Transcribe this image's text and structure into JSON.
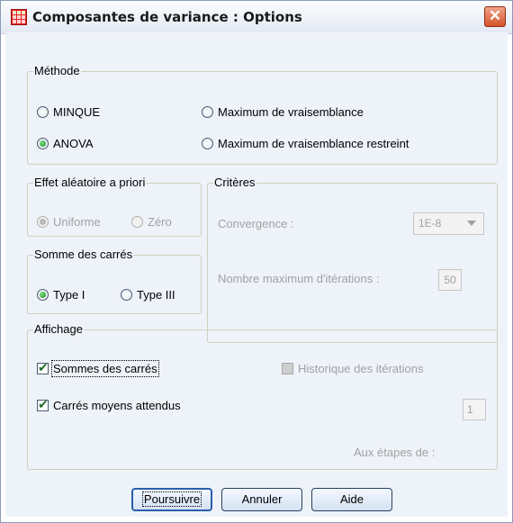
{
  "window": {
    "title": "Composantes de variance : Options",
    "close_glyph": "✕"
  },
  "methode": {
    "label": "Méthode",
    "options": [
      "MINQUE",
      "ANOVA",
      "Maximum de vraisemblance",
      "Maximum de vraisemblance restreint"
    ],
    "selected": "ANOVA"
  },
  "effet": {
    "label": "Effet aléatoire a priori",
    "options": [
      "Uniforme",
      "Zéro"
    ],
    "selected": "Uniforme",
    "enabled": false
  },
  "criteres": {
    "label": "Critères",
    "convergence_label": "Convergence :",
    "convergence_value": "1E-8",
    "max_iter_label": "Nombre maximum d'itérations :",
    "max_iter_value": "50",
    "enabled": false
  },
  "somme": {
    "label": "Somme des carrés",
    "options": [
      "Type I",
      "Type III"
    ],
    "selected": "Type I"
  },
  "affichage": {
    "label": "Affichage",
    "sommes_carres": "Sommes des carrés",
    "carres_moyens": "Carrés moyens attendus",
    "historique": "Historique des itérations",
    "step_value": "1",
    "steps_label": "Aux étapes de :"
  },
  "buttons": {
    "continue": "Poursuivre",
    "cancel": "Annuler",
    "help": "Aide"
  },
  "colors": {
    "accent_green": "#1e8f2a",
    "panel_bg": "#eef2f9",
    "disabled_text": "#a2a2a2"
  }
}
